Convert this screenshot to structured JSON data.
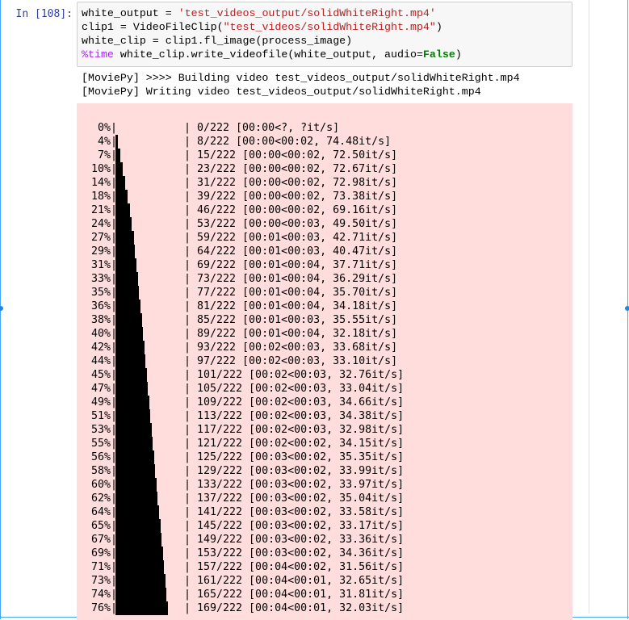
{
  "cell": {
    "prompt": "In [108]:",
    "code": {
      "line1": {
        "var": "white_output",
        "op": " = ",
        "str": "'test_videos_output/solidWhiteRight.mp4'"
      },
      "line2": {
        "pre": "clip1 = VideoFileClip(",
        "str": "\"test_videos/solidWhiteRight.mp4\"",
        "post": ")"
      },
      "line3": {
        "text": "white_clip = clip1.fl_image(process_image)"
      },
      "line4": {
        "magic": "%time",
        "mid": " white_clip.write_videofile(white_output, audio=",
        "kw": "False",
        "post": ")"
      }
    }
  },
  "output": {
    "lines": [
      "[MoviePy] >>>> Building video test_videos_output/solidWhiteRight.mp4",
      "[MoviePy] Writing video test_videos_output/solidWhiteRight.mp4"
    ]
  },
  "progress": {
    "total": 222,
    "rows": [
      {
        "pct": "0%",
        "fraction": 0.0,
        "stats": "| 0/222 [00:00<?, ?it/s]"
      },
      {
        "pct": "4%",
        "fraction": 0.036,
        "stats": "| 8/222 [00:00<00:02, 74.48it/s]"
      },
      {
        "pct": "7%",
        "fraction": 0.068,
        "stats": "| 15/222 [00:00<00:02, 72.50it/s]"
      },
      {
        "pct": "10%",
        "fraction": 0.104,
        "stats": "| 23/222 [00:00<00:02, 72.67it/s]"
      },
      {
        "pct": "14%",
        "fraction": 0.14,
        "stats": "| 31/222 [00:00<00:02, 72.98it/s]"
      },
      {
        "pct": "18%",
        "fraction": 0.176,
        "stats": "| 39/222 [00:00<00:02, 73.38it/s]"
      },
      {
        "pct": "21%",
        "fraction": 0.207,
        "stats": "| 46/222 [00:00<00:02, 69.16it/s]"
      },
      {
        "pct": "24%",
        "fraction": 0.239,
        "stats": "| 53/222 [00:00<00:03, 49.50it/s]"
      },
      {
        "pct": "27%",
        "fraction": 0.266,
        "stats": "| 59/222 [00:01<00:03, 42.71it/s]"
      },
      {
        "pct": "29%",
        "fraction": 0.288,
        "stats": "| 64/222 [00:01<00:03, 40.47it/s]"
      },
      {
        "pct": "31%",
        "fraction": 0.311,
        "stats": "| 69/222 [00:01<00:04, 37.71it/s]"
      },
      {
        "pct": "33%",
        "fraction": 0.329,
        "stats": "| 73/222 [00:01<00:04, 36.29it/s]"
      },
      {
        "pct": "35%",
        "fraction": 0.347,
        "stats": "| 77/222 [00:01<00:04, 35.70it/s]"
      },
      {
        "pct": "36%",
        "fraction": 0.365,
        "stats": "| 81/222 [00:01<00:04, 34.18it/s]"
      },
      {
        "pct": "38%",
        "fraction": 0.383,
        "stats": "| 85/222 [00:01<00:03, 35.55it/s]"
      },
      {
        "pct": "40%",
        "fraction": 0.401,
        "stats": "| 89/222 [00:01<00:04, 32.18it/s]"
      },
      {
        "pct": "42%",
        "fraction": 0.419,
        "stats": "| 93/222 [00:02<00:03, 33.68it/s]"
      },
      {
        "pct": "44%",
        "fraction": 0.437,
        "stats": "| 97/222 [00:02<00:03, 33.10it/s]"
      },
      {
        "pct": "45%",
        "fraction": 0.455,
        "stats": "| 101/222 [00:02<00:03, 32.76it/s]"
      },
      {
        "pct": "47%",
        "fraction": 0.473,
        "stats": "| 105/222 [00:02<00:03, 33.04it/s]"
      },
      {
        "pct": "49%",
        "fraction": 0.491,
        "stats": "| 109/222 [00:02<00:03, 34.66it/s]"
      },
      {
        "pct": "51%",
        "fraction": 0.509,
        "stats": "| 113/222 [00:02<00:03, 34.38it/s]"
      },
      {
        "pct": "53%",
        "fraction": 0.527,
        "stats": "| 117/222 [00:02<00:03, 32.98it/s]"
      },
      {
        "pct": "55%",
        "fraction": 0.545,
        "stats": "| 121/222 [00:02<00:02, 34.15it/s]"
      },
      {
        "pct": "56%",
        "fraction": 0.563,
        "stats": "| 125/222 [00:03<00:02, 35.35it/s]"
      },
      {
        "pct": "58%",
        "fraction": 0.581,
        "stats": "| 129/222 [00:03<00:02, 33.99it/s]"
      },
      {
        "pct": "60%",
        "fraction": 0.599,
        "stats": "| 133/222 [00:03<00:02, 33.97it/s]"
      },
      {
        "pct": "62%",
        "fraction": 0.617,
        "stats": "| 137/222 [00:03<00:02, 35.04it/s]"
      },
      {
        "pct": "64%",
        "fraction": 0.635,
        "stats": "| 141/222 [00:03<00:02, 33.58it/s]"
      },
      {
        "pct": "65%",
        "fraction": 0.653,
        "stats": "| 145/222 [00:03<00:02, 33.17it/s]"
      },
      {
        "pct": "67%",
        "fraction": 0.671,
        "stats": "| 149/222 [00:03<00:02, 33.36it/s]"
      },
      {
        "pct": "69%",
        "fraction": 0.689,
        "stats": "| 153/222 [00:03<00:02, 34.36it/s]"
      },
      {
        "pct": "71%",
        "fraction": 0.707,
        "stats": "| 157/222 [00:04<00:02, 31.56it/s]"
      },
      {
        "pct": "73%",
        "fraction": 0.725,
        "stats": "| 161/222 [00:04<00:01, 32.65it/s]"
      },
      {
        "pct": "74%",
        "fraction": 0.743,
        "stats": "| 165/222 [00:04<00:01, 31.81it/s]"
      },
      {
        "pct": "76%",
        "fraction": 0.761,
        "stats": "| 169/222 [00:04<00:01, 32.03it/s]"
      }
    ]
  },
  "colors": {
    "stderr_bg": "#ffdddd",
    "prompt": "#303f9f",
    "string": "#ba2121",
    "magic": "#aa22ff",
    "keyword": "#008000",
    "selected_border": "#42a5f5"
  }
}
